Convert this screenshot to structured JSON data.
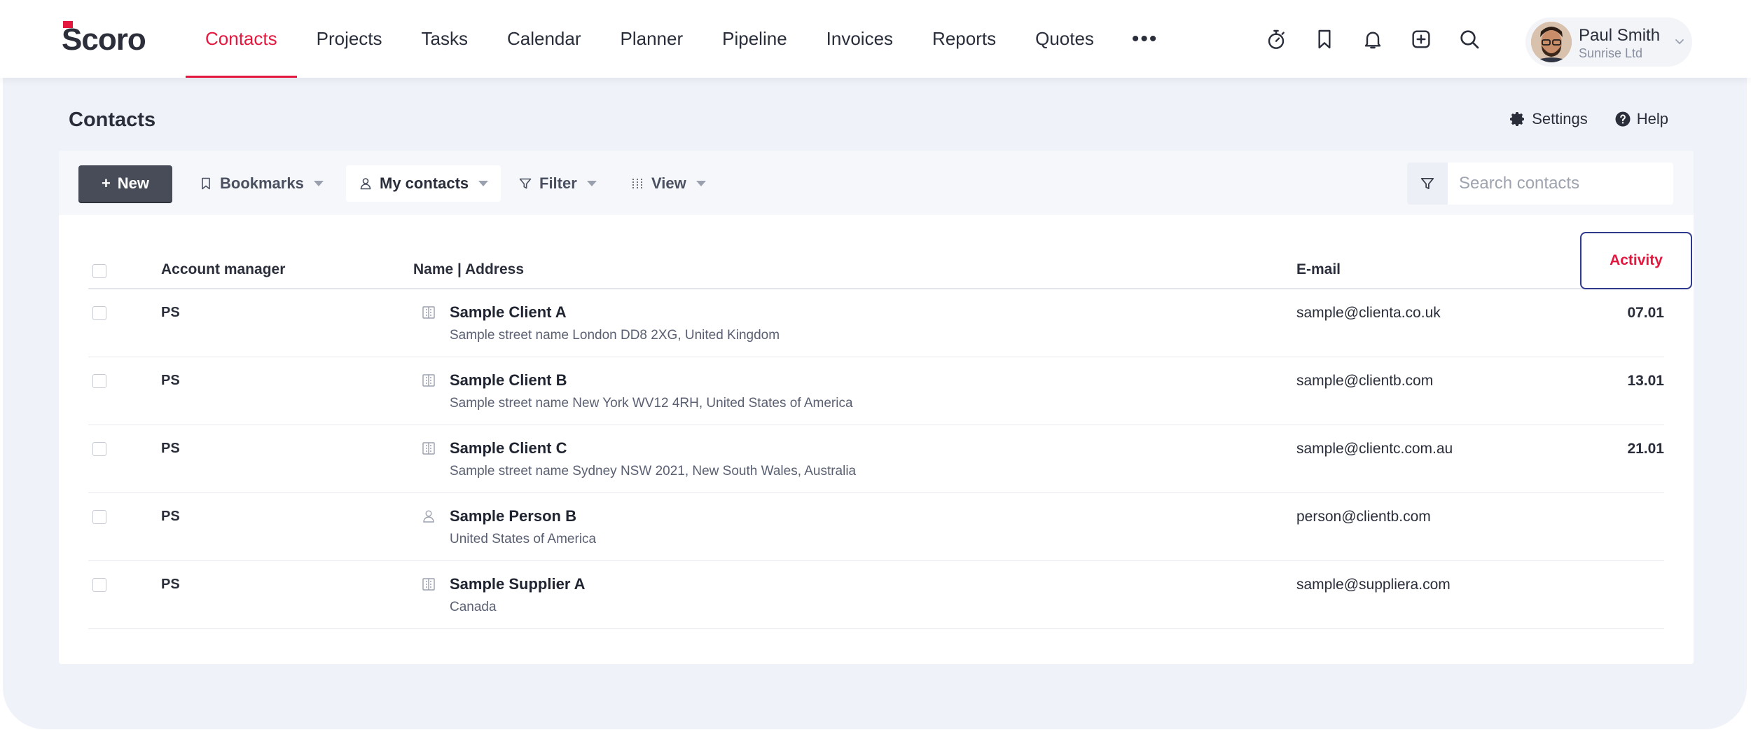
{
  "app": {
    "logo_text": "Scoro"
  },
  "nav": {
    "items": [
      {
        "label": "Contacts",
        "active": true
      },
      {
        "label": "Projects"
      },
      {
        "label": "Tasks"
      },
      {
        "label": "Calendar"
      },
      {
        "label": "Planner"
      },
      {
        "label": "Pipeline"
      },
      {
        "label": "Invoices"
      },
      {
        "label": "Reports"
      },
      {
        "label": "Quotes"
      }
    ],
    "more_label": "•••"
  },
  "header_icons": [
    "timer-icon",
    "bookmark-icon",
    "bell-icon",
    "add-square-icon",
    "search-icon"
  ],
  "user": {
    "name": "Paul Smith",
    "company": "Sunrise Ltd"
  },
  "page": {
    "title": "Contacts",
    "settings_label": "Settings",
    "help_label": "Help"
  },
  "toolbar": {
    "new_label": "New",
    "bookmarks_label": "Bookmarks",
    "my_contacts_label": "My contacts",
    "filter_label": "Filter",
    "view_label": "View",
    "search_placeholder": "Search contacts"
  },
  "table": {
    "headers": {
      "account_manager": "Account manager",
      "name_address": "Name | Address",
      "email": "E-mail",
      "activity": "Activity"
    },
    "rows": [
      {
        "manager": "PS",
        "type": "company",
        "name": "Sample Client A",
        "address": "Sample street name London DD8 2XG, United Kingdom",
        "email": "sample@clienta.co.uk",
        "activity": "07.01"
      },
      {
        "manager": "PS",
        "type": "company",
        "name": "Sample Client B",
        "address": "Sample street name New York WV12 4RH, United States of America",
        "email": "sample@clientb.com",
        "activity": "13.01"
      },
      {
        "manager": "PS",
        "type": "company",
        "name": "Sample Client C",
        "address": "Sample street name Sydney NSW 2021, New South Wales, Australia",
        "email": "sample@clientc.com.au",
        "activity": "21.01"
      },
      {
        "manager": "PS",
        "type": "person",
        "name": "Sample Person B",
        "address": "United States of America",
        "email": "person@clientb.com",
        "activity": ""
      },
      {
        "manager": "PS",
        "type": "company",
        "name": "Sample Supplier A",
        "address": "Canada",
        "email": "sample@suppliera.com",
        "activity": ""
      }
    ]
  },
  "colors": {
    "accent": "#e4173f",
    "highlight_border": "#2f3a8f",
    "button_dark": "#474c58",
    "background": "#eff2f8"
  }
}
